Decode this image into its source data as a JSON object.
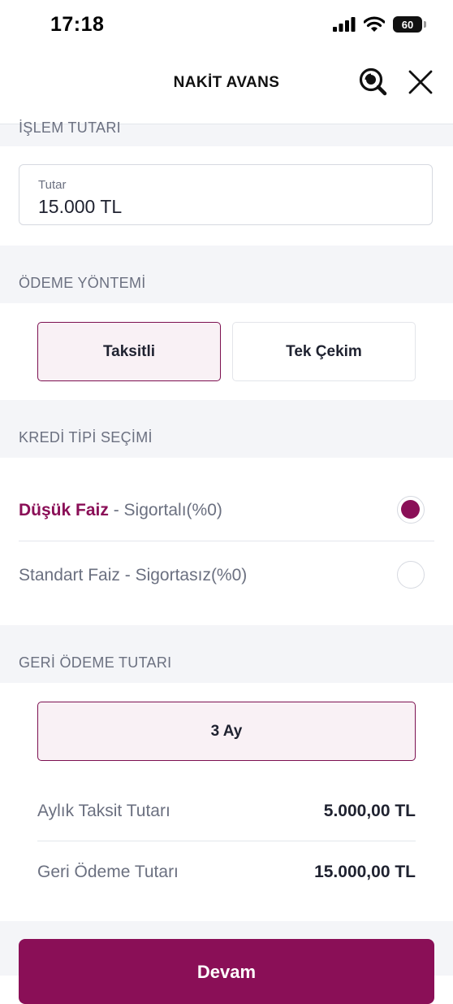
{
  "status_bar": {
    "time": "17:18",
    "battery_level": "60",
    "icons": [
      "signal-icon",
      "wifi-icon",
      "battery-icon"
    ]
  },
  "header": {
    "title": "NAKİT AVANS",
    "icons": [
      "search-icon",
      "close-icon"
    ]
  },
  "sections": {
    "amount": {
      "title": "İŞLEM TUTARI",
      "field_label": "Tutar",
      "field_value": "15.000 TL"
    },
    "payment_method": {
      "title": "ÖDEME YÖNTEMİ",
      "options": [
        "Taksitli",
        "Tek Çekim"
      ],
      "selected": "Taksitli"
    },
    "credit_type": {
      "title": "KREDİ TİPİ SEÇİMİ",
      "options": [
        {
          "name": "Düşük Faiz",
          "detail": " - Sigortalı(%0)",
          "checked": true
        },
        {
          "name": "Standart Faiz",
          "detail": " - Sigortasız(%0)",
          "checked": false
        }
      ]
    },
    "repayment": {
      "title": "GERİ ÖDEME TUTARI",
      "term_label": "3 Ay",
      "rows": [
        {
          "label": "Aylık Taksit Tutarı",
          "value": "5.000,00 TL"
        },
        {
          "label": "Geri Ödeme Tutarı",
          "value": "15.000,00 TL"
        }
      ]
    }
  },
  "footer": {
    "button_label": "Devam"
  },
  "colors": {
    "accent": "#8a0f57",
    "accent_light": "#f9f1f5",
    "section_bg": "#f4f5f8",
    "muted_text": "#6b7080"
  }
}
